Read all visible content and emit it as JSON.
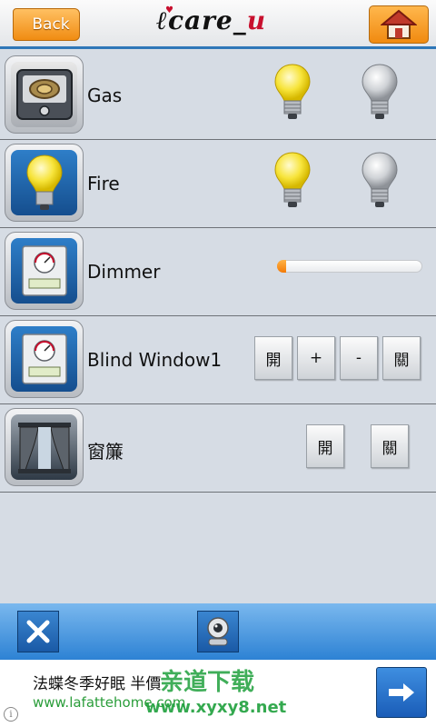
{
  "header": {
    "back_label": "Back",
    "logo": {
      "prefix": "care_",
      "suffix": "u"
    },
    "home_icon": "home-icon"
  },
  "rows": [
    {
      "label": "Gas",
      "icon": "gas-stove-icon",
      "control": "bulbs",
      "on_bulb": true,
      "off_bulb": true
    },
    {
      "label": "Fire",
      "icon": "lightbulb-icon",
      "control": "bulbs",
      "on_bulb": true,
      "off_bulb": true
    },
    {
      "label": "Dimmer",
      "icon": "thermostat-icon",
      "control": "slider",
      "level": 0.03
    },
    {
      "label": "Blind Window1",
      "icon": "thermostat-icon",
      "control": "buttons",
      "buttons": [
        "開",
        "+",
        "-",
        "關"
      ]
    },
    {
      "label": "窗簾",
      "icon": "curtain-icon",
      "control": "buttons",
      "buttons": [
        "開",
        "關"
      ]
    }
  ],
  "toolbar": {
    "close_icon": "close-icon",
    "camera_icon": "webcam-icon"
  },
  "ad": {
    "text": "法蝶冬季好眠 半價",
    "url": "www.lafattehome.com",
    "watermark": "亲道下载",
    "watermark_url": "www.xyxy8.net",
    "info_label": "i"
  },
  "colors": {
    "accent_orange": "#f08c12",
    "header_line": "#2f77b8",
    "toolbar_blue": "#2d82d4",
    "background": "#d6dce4"
  }
}
